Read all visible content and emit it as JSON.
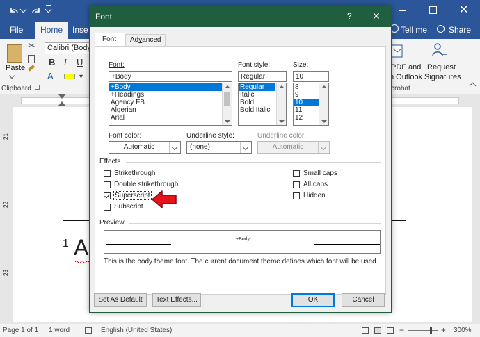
{
  "word": {
    "tabs": [
      "File",
      "Home",
      "Inse"
    ],
    "right_tabs": [
      "Tell me",
      "Share"
    ],
    "font_box": "Calibri (Body)",
    "clipboard_label": "Clipboard",
    "paste_label": "Paste",
    "acrobat": {
      "pdf_label": "PDF and\nn Outlook",
      "pdf_label_line1": "PDF and",
      "pdf_label_line2": "n Outlook",
      "request_line1": "Request",
      "request_line2": "Signatures",
      "group": "crobat"
    },
    "vruler_numbers": [
      "21",
      "22",
      "23"
    ],
    "doc_superscript": "1",
    "doc_letter": "A",
    "status": {
      "page": "Page 1 of 1",
      "words": "1 word",
      "language": "English (United States)",
      "zoom": "300%",
      "zoom_minus": "−",
      "zoom_plus": "+"
    },
    "colors": {
      "titlebar": "#2b579a",
      "dialog_title": "#1f5f3f",
      "selection": "#0078d7"
    }
  },
  "dialog": {
    "title": "Font",
    "help": "?",
    "close": "✕",
    "tabs": [
      {
        "label": "Font",
        "underline_char": "n"
      },
      {
        "label": "Advanced",
        "underline_char": "v"
      }
    ],
    "font": {
      "label": "Font:",
      "value": "+Body",
      "items": [
        "+Body",
        "+Headings",
        "Agency FB",
        "Algerian",
        "Arial"
      ],
      "selected_index": 0
    },
    "font_style": {
      "label": "Font style:",
      "value": "Regular",
      "items": [
        "Regular",
        "Italic",
        "Bold",
        "Bold Italic"
      ],
      "selected_index": 0
    },
    "size": {
      "label": "Size:",
      "value": "10",
      "items": [
        "8",
        "9",
        "10",
        "11",
        "12"
      ],
      "selected_index": 2
    },
    "font_color": {
      "label": "Font color:",
      "value": "Automatic"
    },
    "underline_style": {
      "label": "Underline style:",
      "value": "(none)"
    },
    "underline_color": {
      "label": "Underline color:",
      "value": "Automatic"
    },
    "effects": {
      "label": "Effects",
      "left": [
        {
          "label": "Strikethrough",
          "checked": false
        },
        {
          "label": "Double strikethrough",
          "checked": false
        },
        {
          "label": "Superscript",
          "checked": true
        },
        {
          "label": "Subscript",
          "checked": false
        }
      ],
      "right": [
        {
          "label": "Small caps",
          "checked": false
        },
        {
          "label": "All caps",
          "checked": false
        },
        {
          "label": "Hidden",
          "checked": false
        }
      ]
    },
    "preview": {
      "label": "Preview",
      "sample": "+Body",
      "description": "This is the body theme font. The current document theme defines which font will be used."
    },
    "buttons": {
      "set_default": "Set As Default",
      "text_effects": "Text Effects...",
      "ok": "OK",
      "cancel": "Cancel"
    },
    "annotation_color": "#e8141b"
  }
}
